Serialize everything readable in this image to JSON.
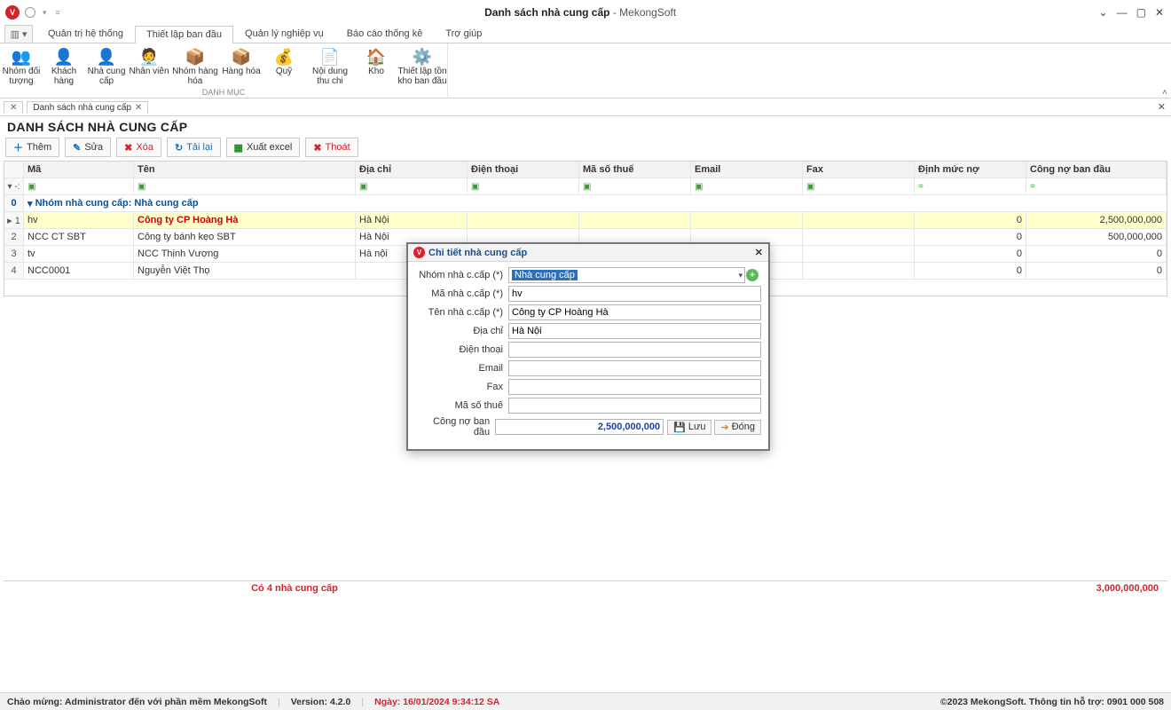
{
  "window": {
    "title_main": "Danh sách nhà cung cấp",
    "title_suffix": " - MekongSoft"
  },
  "ribbon_tabs": [
    "Quản trị hệ thống",
    "Thiết lập ban đầu",
    "Quản lý nghiệp vụ",
    "Báo cáo thống kê",
    "Trợ giúp"
  ],
  "ribbon_active_index": 1,
  "ribbon_group_label": "DANH MỤC",
  "ribbon_items": [
    {
      "label": "Nhóm đối tượng"
    },
    {
      "label": "Khách hàng"
    },
    {
      "label": "Nhà cung cấp"
    },
    {
      "label": "Nhân viên"
    },
    {
      "label": "Nhóm hàng hóa"
    },
    {
      "label": "Hàng hóa"
    },
    {
      "label": "Quỹ"
    },
    {
      "label": "Nội dung thu chi"
    },
    {
      "label": "Kho"
    },
    {
      "label": "Thiết lập tồn kho ban đầu"
    }
  ],
  "doc_tab_label": "Danh sách nhà cung cấp",
  "page_title": "DANH SÁCH NHÀ CUNG CẤP",
  "toolbar": {
    "them": "Thêm",
    "sua": "Sửa",
    "xoa": "Xóa",
    "tailai": "Tải lại",
    "xuat": "Xuất excel",
    "thoat": "Thoát"
  },
  "columns": {
    "ma": "Mã",
    "ten": "Tên",
    "diachi": "Địa chỉ",
    "dienthoai": "Điện thoại",
    "masothue": "Mã số thuế",
    "email": "Email",
    "fax": "Fax",
    "dinhmucno": "Định mức nợ",
    "congno": "Công nợ ban đầu"
  },
  "group_label": "Nhóm nhà cung cấp: Nhà cung cấp",
  "group_row_num": "0",
  "rows": [
    {
      "n": "1",
      "ma": "hv",
      "ten": "Công ty CP Hoàng Hà",
      "diachi": "Hà Nội",
      "dm": "0",
      "cn": "2,500,000,000",
      "sel": true
    },
    {
      "n": "2",
      "ma": "NCC CT SBT",
      "ten": "Công ty bánh kẹo SBT",
      "diachi": "Hà Nội",
      "dm": "0",
      "cn": "500,000,000"
    },
    {
      "n": "3",
      "ma": "tv",
      "ten": "NCC Thịnh Vượng",
      "diachi": "Hà nội",
      "dm": "0",
      "cn": "0"
    },
    {
      "n": "4",
      "ma": "NCC0001",
      "ten": "Nguyễn Việt Thọ",
      "diachi": "",
      "dm": "0",
      "cn": "0"
    }
  ],
  "summary": "Có 4 nhà cung cấp",
  "footer_total": "3,000,000,000",
  "modal": {
    "title": "Chi tiết nhà cung cấp",
    "labels": {
      "nhom": "Nhóm nhà c.cấp (*)",
      "ma": "Mã nhà c.cấp (*)",
      "ten": "Tên nhà c.cấp (*)",
      "diachi": "Địa chỉ",
      "dienthoai": "Điện thoại",
      "email": "Email",
      "fax": "Fax",
      "mst": "Mã số thuế",
      "congno": "Công nợ ban đầu"
    },
    "values": {
      "nhom": "Nhà cung cấp",
      "ma": "hv",
      "ten": "Công ty CP Hoàng Hà",
      "diachi": "Hà Nội",
      "dienthoai": "",
      "email": "",
      "fax": "",
      "mst": "",
      "congno": "2,500,000,000"
    },
    "buttons": {
      "luu": "Lưu",
      "dong": "Đóng"
    }
  },
  "status": {
    "welcome": "Chào mừng: Administrator đến với phần mềm MekongSoft",
    "version": "Version: 4.2.0",
    "date": "Ngày: 16/01/2024 9:34:12 SA",
    "right": "©2023 MekongSoft. Thông tin hỗ trợ: 0901 000 508"
  }
}
